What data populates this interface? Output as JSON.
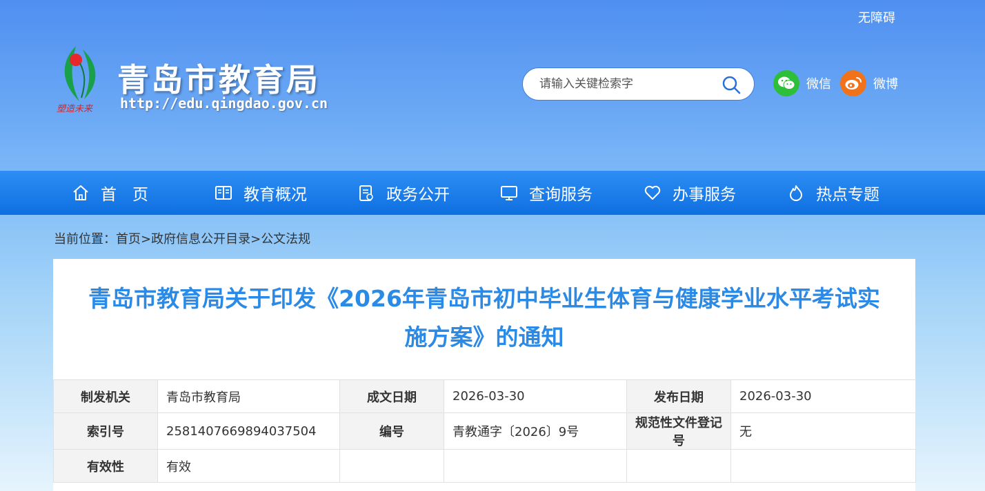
{
  "header": {
    "accessibility": "无障碍",
    "site_title": "青岛市教育局",
    "site_url": "http://edu.qingdao.gov.cn",
    "search_placeholder": "请输入关键检索字",
    "social": {
      "wechat": "微信",
      "weibo": "微博"
    }
  },
  "nav": [
    {
      "label": "首　页",
      "icon": "home-icon"
    },
    {
      "label": "教育概况",
      "icon": "book-icon"
    },
    {
      "label": "政务公开",
      "icon": "document-icon"
    },
    {
      "label": "查询服务",
      "icon": "monitor-icon"
    },
    {
      "label": "办事服务",
      "icon": "heart-icon"
    },
    {
      "label": "热点专题",
      "icon": "flame-icon"
    }
  ],
  "breadcrumb": {
    "prefix": "当前位置：",
    "items": [
      "首页",
      "政府信息公开目录",
      "公文法规"
    ],
    "separator": ">"
  },
  "document": {
    "title_line1": "青岛市教育局关于印发《2026年青岛市初中毕业生体育与健康学业水平考试实",
    "title_line2": "施方案》的通知",
    "meta": {
      "issuer_label": "制发机关",
      "issuer": "青岛市教育局",
      "written_date_label": "成文日期",
      "written_date": "2026-03-30",
      "publish_date_label": "发布日期",
      "publish_date": "2026-03-30",
      "index_label": "索引号",
      "index": "2581407669894037504",
      "number_label": "编号",
      "number": "青教通字〔2026〕9号",
      "registration_label": "规范性文件登记号",
      "registration": "无",
      "validity_label": "有效性",
      "validity": "有效"
    }
  },
  "colors": {
    "nav_bg": "#1a7ce8",
    "title": "#2a8ae6",
    "wechat": "#2dbe3a",
    "weibo": "#f0731c"
  }
}
